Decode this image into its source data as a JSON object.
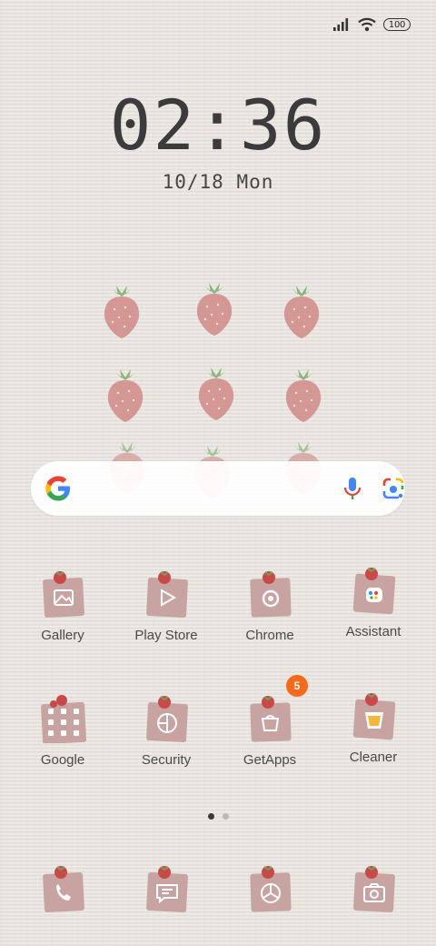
{
  "status_bar": {
    "battery_level": "100",
    "icons": [
      "signal-icon",
      "wifi-icon",
      "battery-icon"
    ]
  },
  "lock": {
    "time": "02:36",
    "date": "10/18 Mon"
  },
  "search_widget": {
    "icons": [
      "google-logo-icon",
      "microphone-icon",
      "google-lens-icon"
    ]
  },
  "apps_row1": [
    {
      "label": "Gallery",
      "icon": "gallery-icon"
    },
    {
      "label": "Play Store",
      "icon": "play-store-icon"
    },
    {
      "label": "Chrome",
      "icon": "chrome-icon"
    },
    {
      "label": "Assistant",
      "icon": "assistant-icon"
    }
  ],
  "apps_row2": [
    {
      "label": "Google",
      "icon": "google-folder-icon"
    },
    {
      "label": "Security",
      "icon": "security-icon"
    },
    {
      "label": "GetApps",
      "icon": "getapps-icon",
      "badge": "5"
    },
    {
      "label": "Cleaner",
      "icon": "cleaner-icon"
    }
  ],
  "pager": {
    "pages": 2,
    "active": 1
  },
  "dock": [
    {
      "icon": "phone-icon"
    },
    {
      "icon": "messages-icon"
    },
    {
      "icon": "browser-icon"
    },
    {
      "icon": "camera-icon"
    }
  ],
  "colors": {
    "wallpaper": "#e9e5e0",
    "tile": "#c7a4a1",
    "berry": "#d08a86",
    "leaf": "#7fae6c",
    "badge": "#f56a1c",
    "text": "#4a4a4a"
  }
}
